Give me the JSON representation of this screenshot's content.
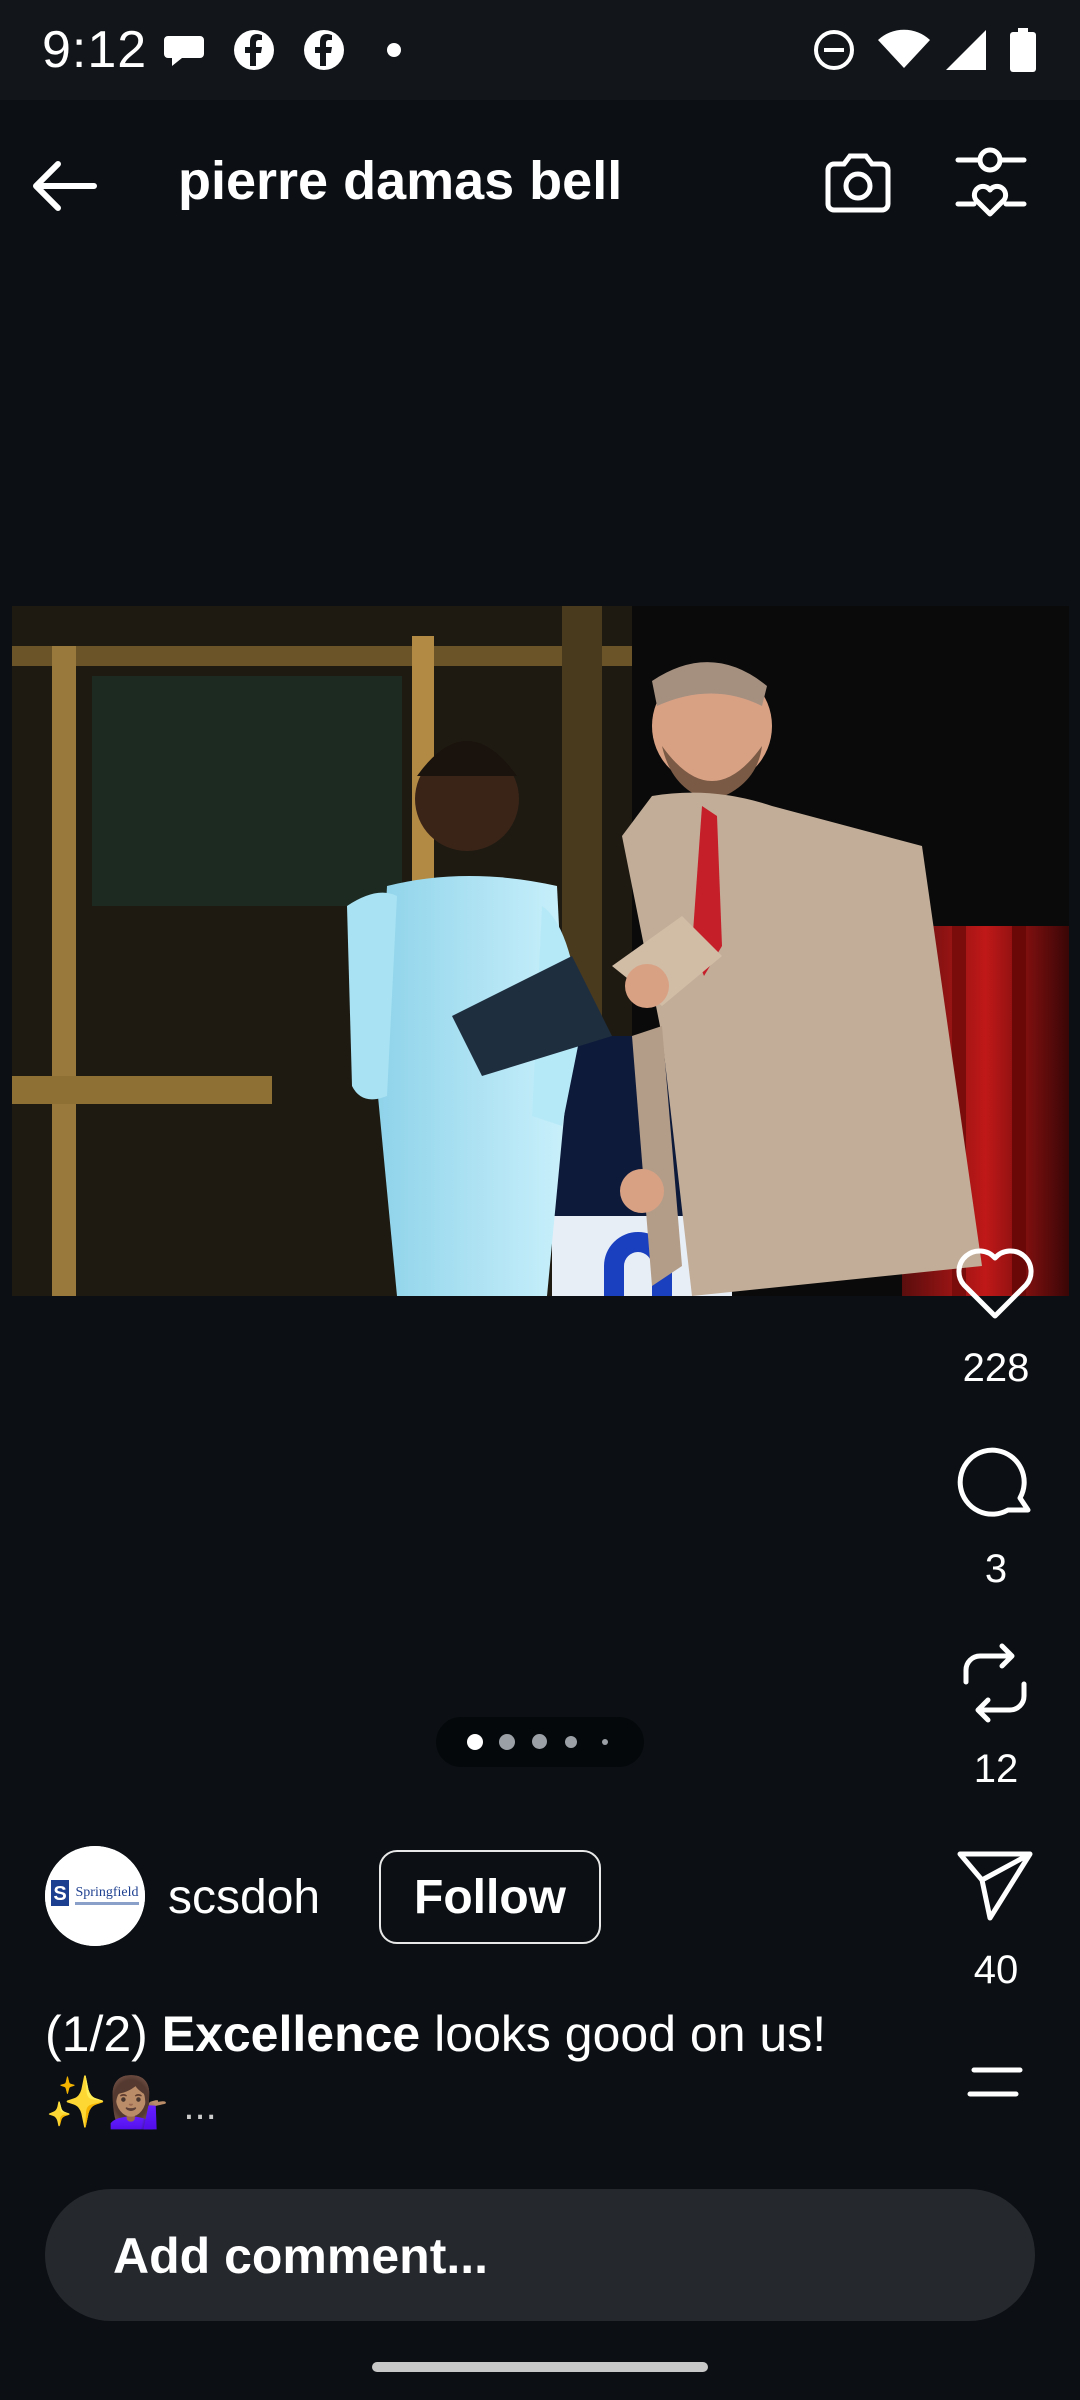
{
  "status_bar": {
    "time": "9:12",
    "left_icons": [
      "chat-bubble-icon",
      "facebook-icon",
      "facebook-icon",
      "dot-icon"
    ],
    "right_icons": [
      "do-not-disturb-icon",
      "wifi-icon",
      "signal-icon",
      "battery-icon"
    ]
  },
  "header": {
    "title": "pierre damas bell",
    "back_icon": "arrow-left-icon",
    "camera_icon": "camera-icon",
    "filter_icon": "sliders-heart-icon"
  },
  "actions": {
    "like_count": "228",
    "comment_count": "3",
    "repost_count": "12",
    "share_count": "40"
  },
  "pagination": {
    "dot_count": 5,
    "active_index": 0
  },
  "author": {
    "username": "scsdoh",
    "follow_label": "Follow",
    "avatar_text": "Springfield"
  },
  "caption": {
    "prefix": "(1/2)",
    "bold": "Excellence",
    "text": "looks good on us!",
    "emoji": "✨💁🏽‍♀️",
    "more": "..."
  },
  "comment": {
    "placeholder": "Add comment..."
  },
  "colors": {
    "background": "#0c1014",
    "status_bar": "#121519",
    "comment_bar": "#25292e"
  }
}
